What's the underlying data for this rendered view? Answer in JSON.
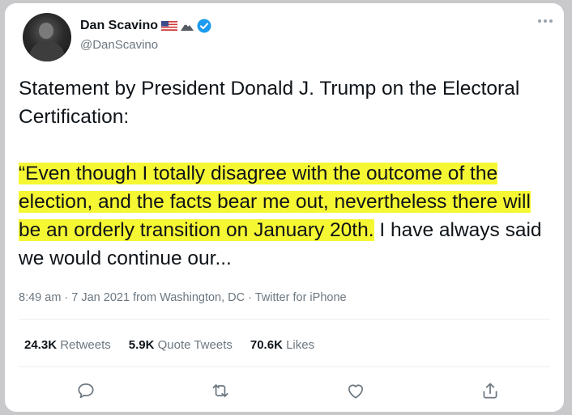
{
  "user": {
    "display_name": "Dan Scavino",
    "handle": "@DanScavino"
  },
  "tweet": {
    "line1": "Statement by President Donald J. Trump on the Electoral Certification:",
    "quote_highlighted": "“Even though I totally disagree with the outcome of the election, and the facts bear me out, nevertheless there will be an orderly transition on January 20th.",
    "quote_rest": " I have always said we would continue our...",
    "highlight_color": "#f6f733"
  },
  "meta": "8:49 am · 7 Jan 2021 from Washington, DC · Twitter for iPhone",
  "stats": {
    "retweets_count": "24.3K",
    "retweets_label": "Retweets",
    "quotes_count": "5.9K",
    "quotes_label": "Quote Tweets",
    "likes_count": "70.6K",
    "likes_label": "Likes"
  },
  "icons": [
    "flag-icon",
    "mountain-icon",
    "verified-icon",
    "more-icon",
    "reply-icon",
    "retweet-icon",
    "like-icon",
    "share-icon"
  ],
  "colors": {
    "accent": "#1d9bf0",
    "text": "#0f1419",
    "secondary": "#6c7780"
  }
}
